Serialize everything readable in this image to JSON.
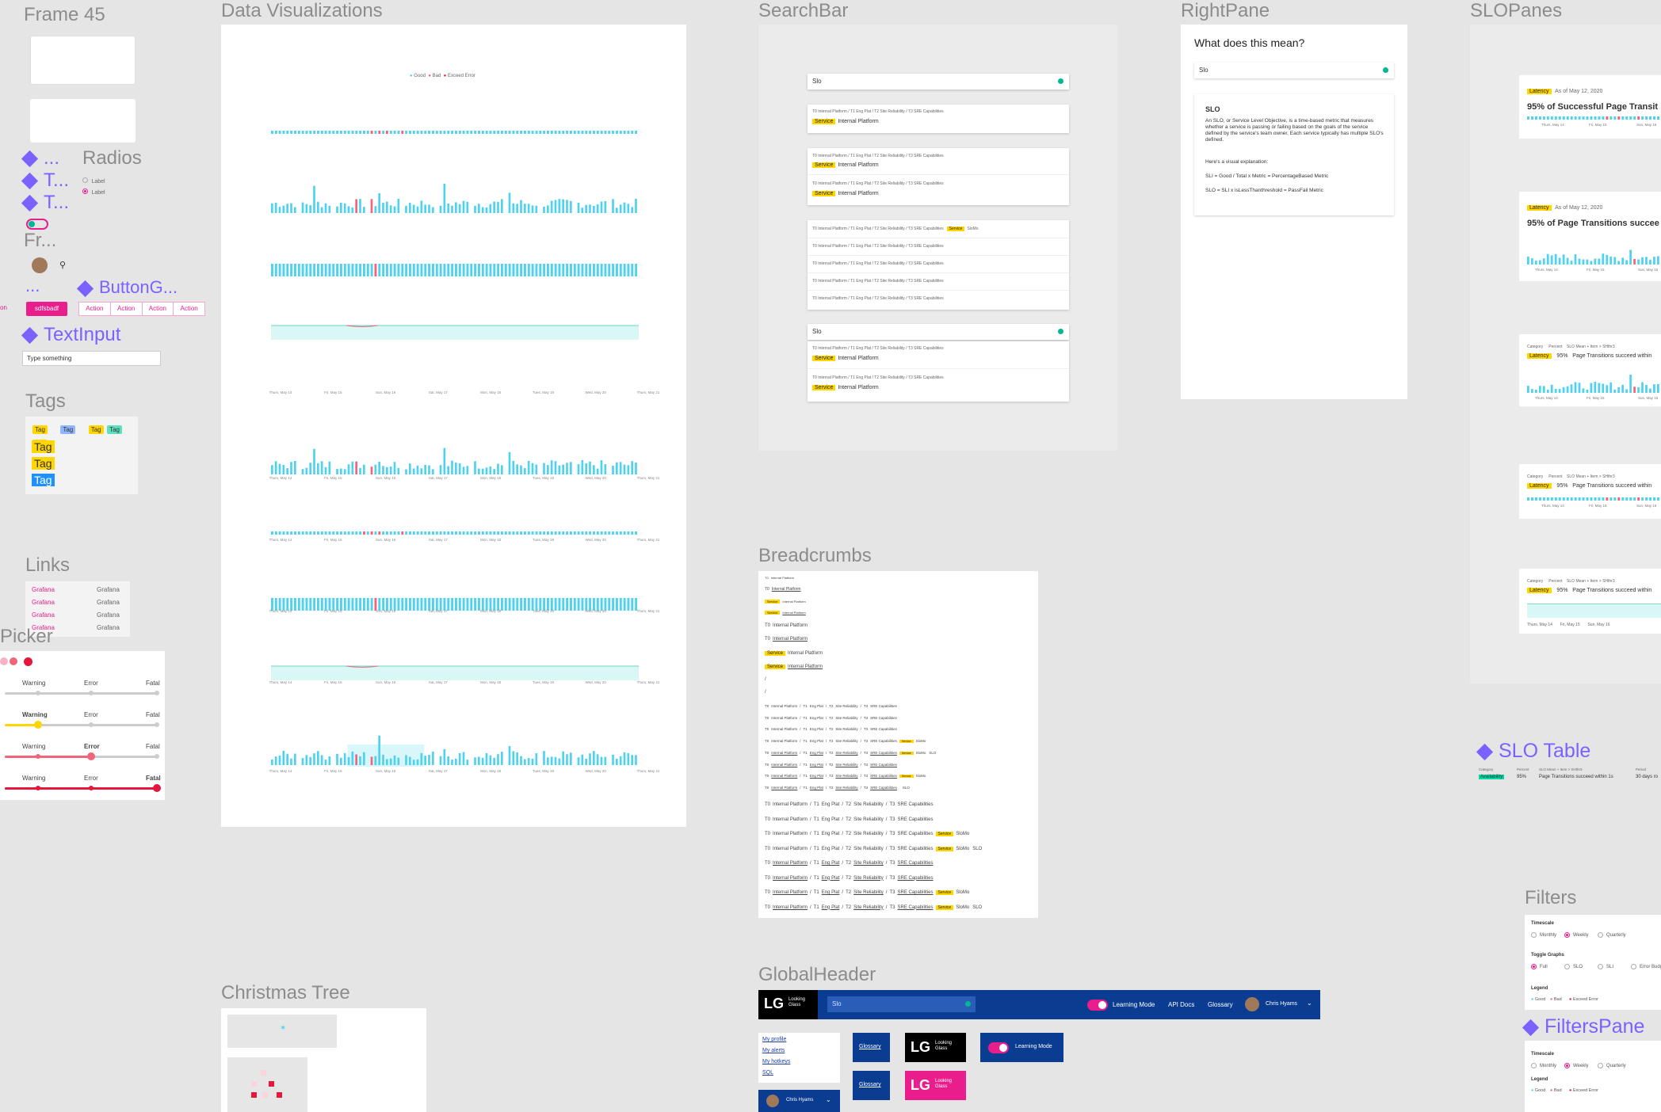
{
  "frames": {
    "frame45": "Frame 45",
    "data_viz": "Data Visualizations",
    "searchbar": "SearchBar",
    "rightpane": "RightPane",
    "slopanes": "SLOPanes",
    "radios": "Radios",
    "button_group": "ButtonG...",
    "text_input": "TextInput",
    "tags": "Tags",
    "links": "Links",
    "picker": "Picker",
    "breadcrumbs": "Breadcrumbs",
    "globalheader": "GlobalHeader",
    "christmas_tree": "Christmas Tree",
    "slo_table": "SLO Table",
    "filters": "Filters",
    "filters_pane": "FiltersPane",
    "t1": "T...",
    "t2": "T...",
    "fr": "Fr...",
    "dots1": "...",
    "dots2": "..."
  },
  "left": {
    "radio_label": "Label",
    "button_primary": "sdfsbadf",
    "actions": [
      "Action",
      "Action",
      "Action",
      "Action"
    ],
    "text_input_placeholder": "Type something",
    "tag": "Tag",
    "tag_small": "Tag",
    "grafana": "Grafana",
    "picker_levels": [
      "Warning",
      "Error",
      "Fatal"
    ]
  },
  "dataviz": {
    "legend": [
      "Good",
      "Bad",
      "Exceed Error"
    ],
    "dates": [
      "Thurs, May 14",
      "Fri, May 15",
      "Sun, May 16",
      "Sat, May 17",
      "Mon, May 18",
      "Tues, May 19",
      "Wed, May 20",
      "Thurs, May 21"
    ]
  },
  "searchbar": {
    "query": "Slo",
    "crumb": "T0 Internal Platform  /  T1 Eng Plat  /  T2 Site Reliability  /  T3 SRE Capabilities",
    "service": "Service",
    "result_name": "Internal Platform",
    "crumb_service_label": "SloMo"
  },
  "rightpane": {
    "question": "What does this mean?",
    "query": "Slo",
    "heading": "SLO",
    "body": "An SLO, or Service Level Objective, is a time-based metric that measures whether a service is passing or failing based on the goals of the service defined by the service's team owner. Each service typically has multiple SLO's defined.",
    "visual": "Here's a visual explanation:",
    "formula1": "SLI = Good / Total x Metric = PercentageBased Metric",
    "formula2": "SLO = SLI x isLessThanthreshold = PassFail Metric"
  },
  "slopanes": {
    "latency": "Latency",
    "date": "As of May 12, 2020",
    "title1": "95% of Successful Page Transit",
    "title2": "95% of Page Transitions succee",
    "pct": "95%",
    "desc": "Page Transitions succeed within",
    "category": "Category",
    "percent": "Percent",
    "slo_desc_hdr": "SLO Mean + Item > SHthr3",
    "dates_short": [
      "Thurs, May 14",
      "Fri, May 15",
      "Sun, May 16"
    ]
  },
  "slotable": {
    "category": "Category",
    "percent": "Percent",
    "slo_hdr": "SLO Mean + Item > SHthr3",
    "period_hdr": "Period",
    "availability": "Availability",
    "pct": "95%",
    "desc": "Page Transitions succeed within 1s",
    "period": "30 days ro"
  },
  "breadcrumbs": {
    "t0": "T0",
    "internal_platform": "Internal Platform",
    "service": "Service",
    "full": [
      "T0",
      "Internal Platform",
      "/",
      "T1",
      "Eng Plat",
      "/",
      "T2",
      "Site Reliability",
      "/",
      "T3",
      "SRE Capabilities"
    ],
    "slomo": "SloMo",
    "slo": "SLO"
  },
  "globalheader": {
    "logo": "LG",
    "logo_sub": "Looking Glass",
    "search": "Slo",
    "learning_mode": "Learning Mode",
    "api_docs": "API Docs",
    "glossary": "Glossary",
    "user": "Chris Hyams",
    "menu": [
      "My profile",
      "My alerts",
      "My hotkeys",
      "SQL"
    ]
  },
  "filters": {
    "timescale": "Timescale",
    "timescale_opts": [
      "Monthly",
      "Weekly",
      "Quarterly"
    ],
    "toggle": "Toggle Graphs",
    "toggle_opts": [
      "Full",
      "SLO",
      "SLI",
      "Error Budge"
    ],
    "legend": "Legend",
    "legend_items": [
      "Good",
      "Bad",
      "Exceed Error"
    ]
  },
  "colors": {
    "cyan": "#4fd1f0",
    "red": "#f2647a",
    "pink": "#e91e8c",
    "navy": "#0a3c91",
    "yellow": "#ffd600",
    "purple": "#7b61ff",
    "green": "#00b894"
  }
}
